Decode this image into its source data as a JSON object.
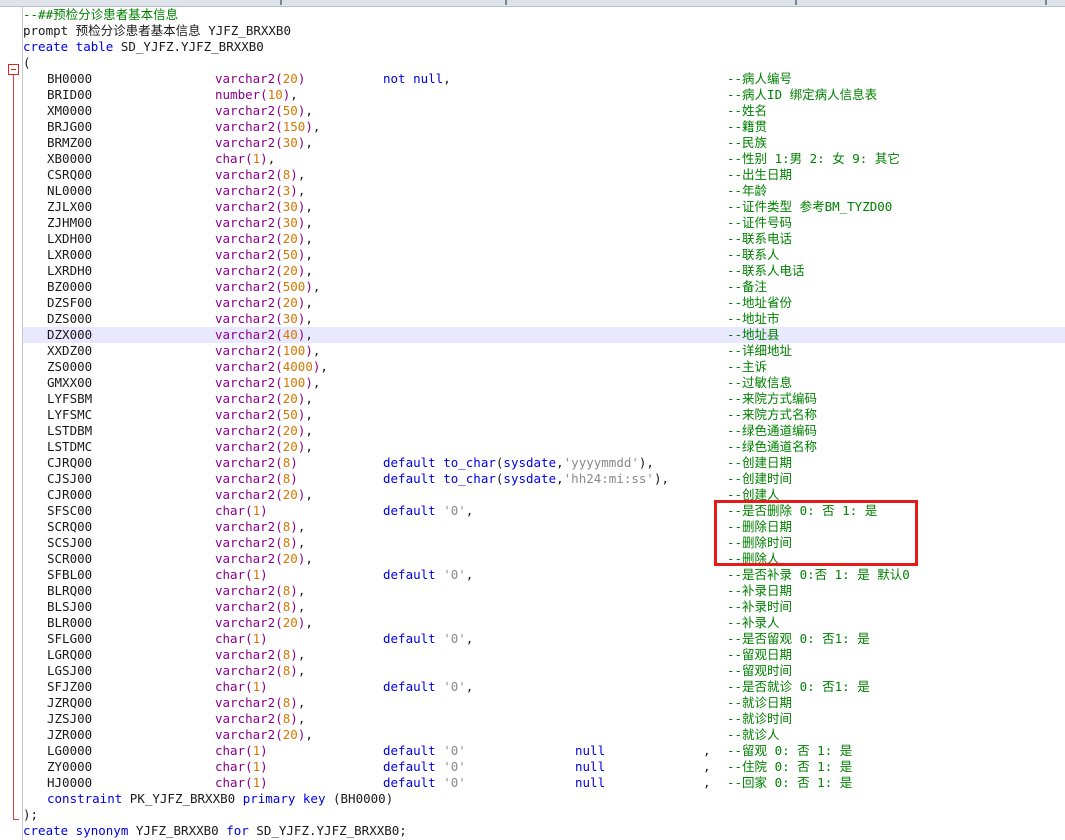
{
  "annotation_color": "#e31b1b",
  "colors": {
    "keyword": "#0000dd",
    "type": "#8a008a",
    "number": "#d47800",
    "string": "#8a8a8a",
    "comment": "#008000"
  },
  "header": [
    [
      [
        "cm",
        "--##预检分诊患者基本信息"
      ]
    ],
    [
      [
        "tx",
        "prompt 预检分诊患者基本信息 YJFZ_BRXXB0"
      ]
    ],
    [
      [
        "kw",
        "create table"
      ],
      [
        "tx",
        " SD_YJFZ.YJFZ_BRXXB0"
      ]
    ],
    [
      [
        "tx",
        "("
      ]
    ]
  ],
  "columns": [
    {
      "name": "BH0000",
      "type": "varchar2",
      "size": "20",
      "extra": [
        [
          "kw",
          "not null"
        ],
        [
          "tx",
          ","
        ]
      ],
      "comment": "--病人编号"
    },
    {
      "name": "BRID00",
      "type": "number",
      "size": "10",
      "comma": ",",
      "comment": "--病人ID 绑定病人信息表"
    },
    {
      "name": "XM0000",
      "type": "varchar2",
      "size": "50",
      "comma": ",",
      "comment": "--姓名"
    },
    {
      "name": "BRJG00",
      "type": "varchar2",
      "size": "150",
      "comma": ",",
      "comment": "--籍贯"
    },
    {
      "name": "BRMZ00",
      "type": "varchar2",
      "size": "30",
      "comma": ",",
      "comment": "--民族"
    },
    {
      "name": "XB0000",
      "type": "char",
      "size": "1",
      "comma": ",",
      "comment": "--性别 1:男 2: 女 9: 其它"
    },
    {
      "name": "CSRQ00",
      "type": "varchar2",
      "size": "8",
      "comma": ",",
      "comment": "--出生日期"
    },
    {
      "name": "NL0000",
      "type": "varchar2",
      "size": "3",
      "comma": ",",
      "comment": "--年龄"
    },
    {
      "name": "ZJLX00",
      "type": "varchar2",
      "size": "30",
      "comma": ",",
      "comment": "--证件类型 参考BM_TYZD00"
    },
    {
      "name": "ZJHM00",
      "type": "varchar2",
      "size": "30",
      "comma": ",",
      "comment": "--证件号码"
    },
    {
      "name": "LXDH00",
      "type": "varchar2",
      "size": "20",
      "comma": ",",
      "comment": "--联系电话"
    },
    {
      "name": "LXR000",
      "type": "varchar2",
      "size": "50",
      "comma": ",",
      "comment": "--联系人"
    },
    {
      "name": "LXRDH0",
      "type": "varchar2",
      "size": "20",
      "comma": ",",
      "comment": "--联系人电话"
    },
    {
      "name": "BZ0000",
      "type": "varchar2",
      "size": "500",
      "comma": ",",
      "comment": "--备注"
    },
    {
      "name": "DZSF00",
      "type": "varchar2",
      "size": "20",
      "comma": ",",
      "comment": "--地址省份"
    },
    {
      "name": "DZS000",
      "type": "varchar2",
      "size": "30",
      "comma": ",",
      "comment": "--地址市"
    },
    {
      "name": "DZX000",
      "type": "varchar2",
      "size": "40",
      "comma": ",",
      "comment": "--地址县",
      "highlight": true
    },
    {
      "name": "XXDZ00",
      "type": "varchar2",
      "size": "100",
      "comma": ",",
      "comment": "--详细地址"
    },
    {
      "name": "ZS0000",
      "type": "varchar2",
      "size": "4000",
      "comma": ",",
      "comment": "--主诉"
    },
    {
      "name": "GMXX00",
      "type": "varchar2",
      "size": "100",
      "comma": ",",
      "comment": "--过敏信息"
    },
    {
      "name": "LYFSBM",
      "type": "varchar2",
      "size": "20",
      "comma": ",",
      "comment": "--来院方式编码"
    },
    {
      "name": "LYFSMC",
      "type": "varchar2",
      "size": "50",
      "comma": ",",
      "comment": "--来院方式名称"
    },
    {
      "name": "LSTDBM",
      "type": "varchar2",
      "size": "20",
      "comma": ",",
      "comment": "--绿色通道编码"
    },
    {
      "name": "LSTDMC",
      "type": "varchar2",
      "size": "20",
      "comma": ",",
      "comment": "--绿色通道名称"
    },
    {
      "name": "CJRQ00",
      "type": "varchar2",
      "size": "8",
      "extra": [
        [
          "kw",
          "default to_char"
        ],
        [
          "tx",
          "("
        ],
        [
          "kw",
          "sysdate"
        ],
        [
          "tx",
          ","
        ],
        [
          "str",
          "'yyyymmdd'"
        ],
        [
          "tx",
          "),"
        ]
      ],
      "comment": "--创建日期"
    },
    {
      "name": "CJSJ00",
      "type": "varchar2",
      "size": "8",
      "extra": [
        [
          "kw",
          "default to_char"
        ],
        [
          "tx",
          "("
        ],
        [
          "kw",
          "sysdate"
        ],
        [
          "tx",
          ","
        ],
        [
          "str",
          "'hh24:mi:ss'"
        ],
        [
          "tx",
          "),"
        ]
      ],
      "comment": "--创建时间"
    },
    {
      "name": "CJR000",
      "type": "varchar2",
      "size": "20",
      "comma": ",",
      "comment": "--创建人"
    },
    {
      "name": "SFSC00",
      "type": "char",
      "size": "1",
      "extra": [
        [
          "kw",
          "default"
        ],
        [
          "tx",
          " "
        ],
        [
          "str",
          "'0'"
        ],
        [
          "tx",
          ","
        ]
      ],
      "comment": "--是否删除 0: 否 1: 是"
    },
    {
      "name": "SCRQ00",
      "type": "varchar2",
      "size": "8",
      "comma": ",",
      "comment": "--删除日期"
    },
    {
      "name": "SCSJ00",
      "type": "varchar2",
      "size": "8",
      "comma": ",",
      "comment": "--删除时间"
    },
    {
      "name": "SCR000",
      "type": "varchar2",
      "size": "20",
      "comma": ",",
      "comment": "--删除人"
    },
    {
      "name": "SFBL00",
      "type": "char",
      "size": "1",
      "extra": [
        [
          "kw",
          "default"
        ],
        [
          "tx",
          " "
        ],
        [
          "str",
          "'0'"
        ],
        [
          "tx",
          ","
        ]
      ],
      "comment": "--是否补录 0:否 1: 是 默认0"
    },
    {
      "name": "BLRQ00",
      "type": "varchar2",
      "size": "8",
      "comma": ",",
      "comment": "--补录日期"
    },
    {
      "name": "BLSJ00",
      "type": "varchar2",
      "size": "8",
      "comma": ",",
      "comment": "--补录时间"
    },
    {
      "name": "BLR000",
      "type": "varchar2",
      "size": "20",
      "comma": ",",
      "comment": "--补录人"
    },
    {
      "name": "SFLG00",
      "type": "char",
      "size": "1",
      "extra": [
        [
          "kw",
          "default"
        ],
        [
          "tx",
          " "
        ],
        [
          "str",
          "'0'"
        ],
        [
          "tx",
          ","
        ]
      ],
      "comment": "--是否留观 0: 否1: 是"
    },
    {
      "name": "LGRQ00",
      "type": "varchar2",
      "size": "8",
      "comma": ",",
      "comment": "--留观日期"
    },
    {
      "name": "LGSJ00",
      "type": "varchar2",
      "size": "8",
      "comma": ",",
      "comment": "--留观时间"
    },
    {
      "name": "SFJZ00",
      "type": "char",
      "size": "1",
      "extra": [
        [
          "kw",
          "default"
        ],
        [
          "tx",
          " "
        ],
        [
          "str",
          "'0'"
        ],
        [
          "tx",
          ","
        ]
      ],
      "comment": "--是否就诊 0: 否1: 是"
    },
    {
      "name": "JZRQ00",
      "type": "varchar2",
      "size": "8",
      "comma": ",",
      "comment": "--就诊日期"
    },
    {
      "name": "JZSJ00",
      "type": "varchar2",
      "size": "8",
      "comma": ",",
      "comment": "--就诊时间"
    },
    {
      "name": "JZR000",
      "type": "varchar2",
      "size": "20",
      "comma": ",",
      "comment": "--就诊人"
    },
    {
      "name": "LG0000",
      "type": "char",
      "size": "1",
      "extra": [
        [
          "kw",
          "default"
        ],
        [
          "tx",
          " "
        ],
        [
          "str",
          "'0'"
        ]
      ],
      "nullkw": "null",
      "comma2": ",",
      "comment": "--留观 0: 否 1: 是"
    },
    {
      "name": "ZY0000",
      "type": "char",
      "size": "1",
      "extra": [
        [
          "kw",
          "default"
        ],
        [
          "tx",
          " "
        ],
        [
          "str",
          "'0'"
        ]
      ],
      "nullkw": "null",
      "comma2": ",",
      "comment": "--住院 0: 否 1: 是"
    },
    {
      "name": "HJ0000",
      "type": "char",
      "size": "1",
      "extra": [
        [
          "kw",
          "default"
        ],
        [
          "tx",
          " "
        ],
        [
          "str",
          "'0'"
        ]
      ],
      "nullkw": "null",
      "comma2": ",",
      "comment": "--回家 0: 否 1: 是"
    }
  ],
  "footer": [
    [
      [
        "kw",
        "constraint"
      ],
      [
        "tx",
        " PK_YJFZ_BRXXB0 "
      ],
      [
        "kw",
        "primary key"
      ],
      [
        "tx",
        " (BH0000)"
      ]
    ],
    [
      [
        "tx",
        ");"
      ]
    ],
    [
      [
        "kw",
        "create synonym"
      ],
      [
        "tx",
        " YJFZ_BRXXB0 "
      ],
      [
        "kw",
        "for"
      ],
      [
        "tx",
        " SD_YJFZ.YJFZ_BRXXB0;"
      ]
    ]
  ]
}
